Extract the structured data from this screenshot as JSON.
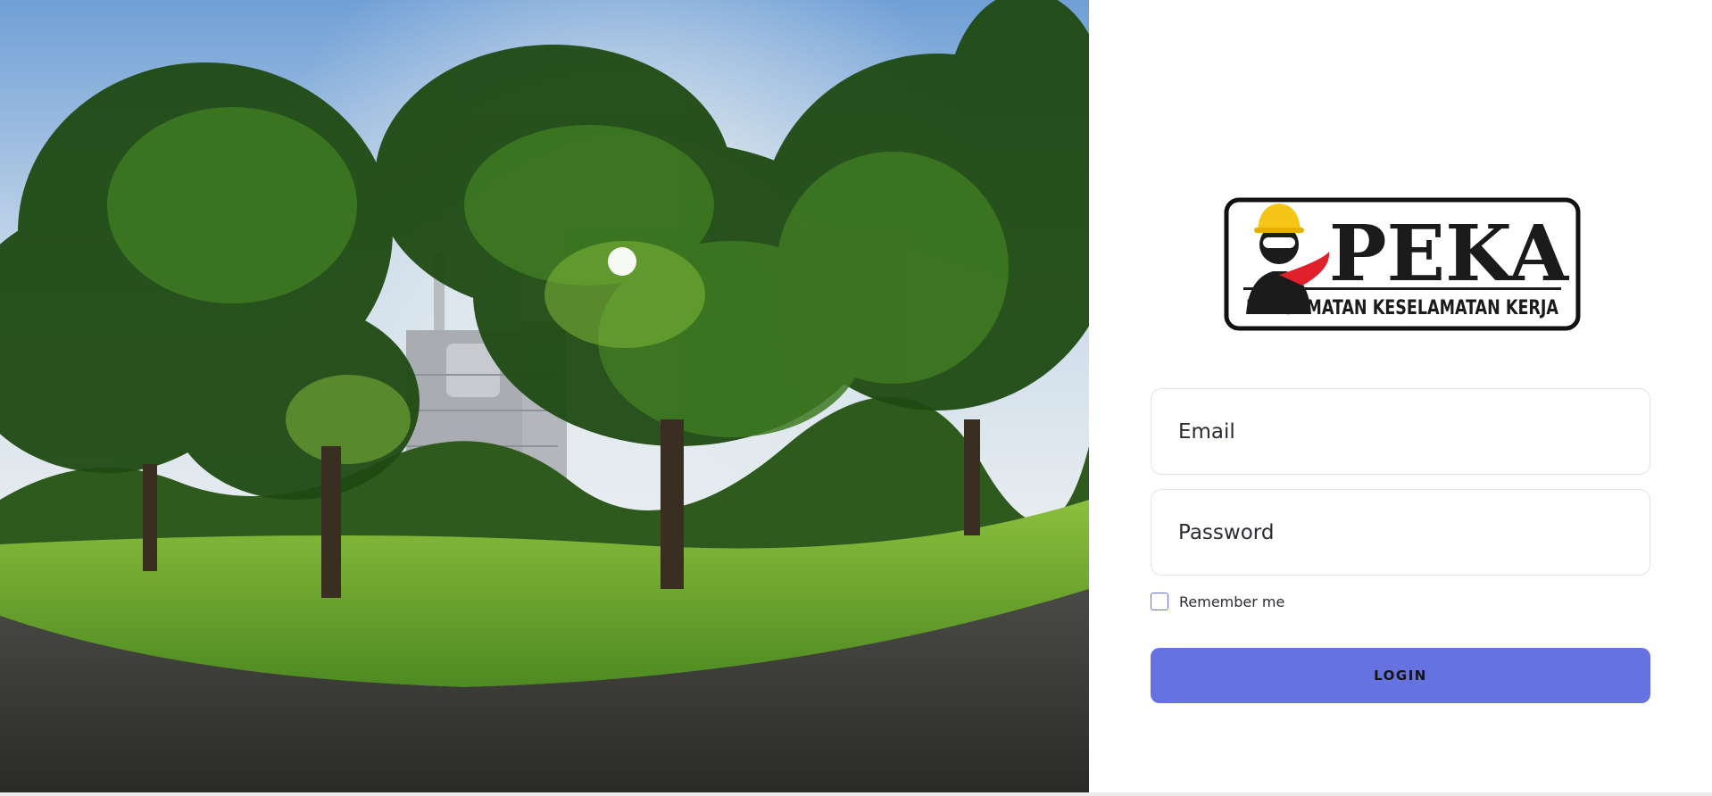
{
  "logo": {
    "brand": "PEKA",
    "tagline": "PENGAMATAN KESELAMATAN KERJA"
  },
  "form": {
    "email_placeholder": "Email",
    "password_placeholder": "Password",
    "remember_label": "Remember me",
    "remember_checked": false,
    "login_label": "LOGIN"
  },
  "colors": {
    "accent": "#6672e0",
    "helmet": "#f5c518",
    "cape": "#e0202a"
  }
}
